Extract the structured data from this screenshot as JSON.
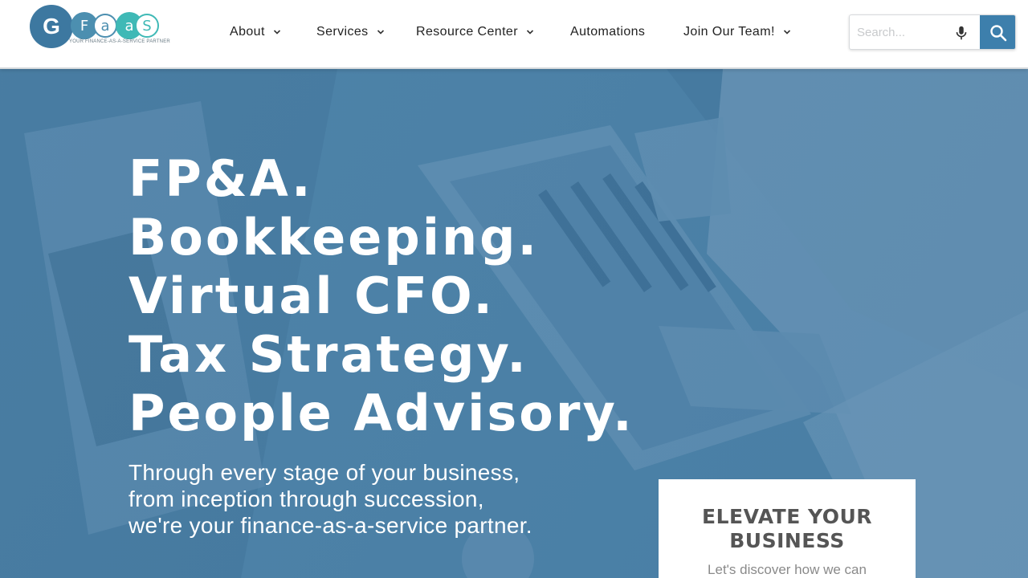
{
  "logo": {
    "mark": "G",
    "letters": [
      "F",
      "a",
      "a",
      "S"
    ],
    "tagline": "YOUR FINANCE-AS-A-SERVICE PARTNER"
  },
  "nav": {
    "items": [
      {
        "label": "About",
        "has_dropdown": true
      },
      {
        "label": "Services",
        "has_dropdown": true
      },
      {
        "label": "Resource Center",
        "has_dropdown": true
      },
      {
        "label": "Automations",
        "has_dropdown": false
      },
      {
        "label": "Join Our Team!",
        "has_dropdown": true
      }
    ]
  },
  "search": {
    "placeholder": "Search...",
    "mic_icon": "microphone-icon",
    "button_icon": "search-icon"
  },
  "hero": {
    "headline": [
      "FP&A.",
      "Bookkeeping.",
      "Virtual CFO.",
      "Tax Strategy.",
      "People Advisory."
    ],
    "subtext": [
      "Through every stage of your business,",
      "from inception through succession,",
      "we're your finance-as-a-service partner."
    ]
  },
  "cta": {
    "title_line1": "ELEVATE YOUR",
    "title_line2": "BUSINESS",
    "text": "Let's discover how we can"
  },
  "colors": {
    "primary": "#3d7fac",
    "teal": "#3fb9b6",
    "hero_overlay": "#4f86ab"
  }
}
